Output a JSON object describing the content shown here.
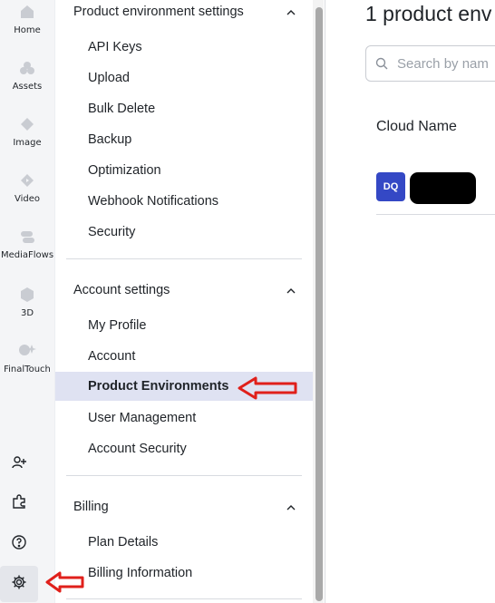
{
  "rail": {
    "items": [
      {
        "label": "Home",
        "icon": "home-icon"
      },
      {
        "label": "Assets",
        "icon": "assets-icon"
      },
      {
        "label": "Image",
        "icon": "image-icon"
      },
      {
        "label": "Video",
        "icon": "video-icon"
      },
      {
        "label": "MediaFlows",
        "icon": "mediaflows-icon"
      },
      {
        "label": "3D",
        "icon": "cube-icon"
      },
      {
        "label": "FinalTouch",
        "icon": "finaltouch-icon"
      }
    ],
    "bottom_icons": [
      "add-user-icon",
      "puzzle-icon",
      "help-icon",
      "gear-icon"
    ]
  },
  "settings": {
    "sections": [
      {
        "title": "Product environment settings",
        "items": [
          "API Keys",
          "Upload",
          "Bulk Delete",
          "Backup",
          "Optimization",
          "Webhook Notifications",
          "Security"
        ]
      },
      {
        "title": "Account settings",
        "items": [
          "My Profile",
          "Account",
          "Product Environments",
          "User Management",
          "Account Security"
        ]
      },
      {
        "title": "Billing",
        "items": [
          "Plan Details",
          "Billing Information"
        ]
      }
    ],
    "active_item": "Product Environments"
  },
  "main": {
    "title": "1 product env",
    "search_placeholder": "Search by nam",
    "column_header": "Cloud Name",
    "rows": [
      {
        "initials": "DQ"
      }
    ]
  },
  "colors": {
    "accent": "#3448c5",
    "active_bg": "#dfe2f2",
    "annotation": "#e0201b"
  }
}
